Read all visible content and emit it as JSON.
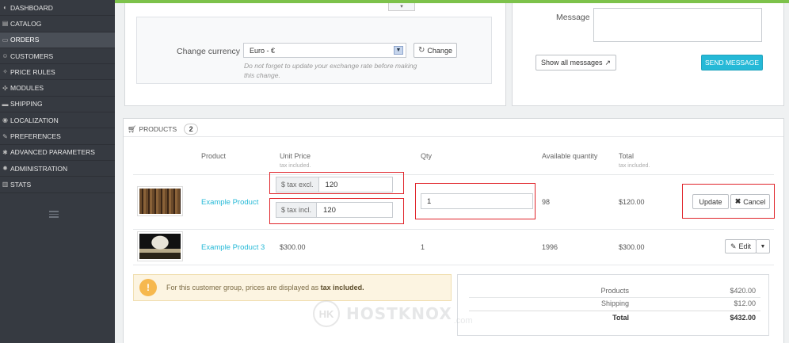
{
  "sidebar": {
    "items": [
      {
        "label": "DASHBOARD",
        "icon": "dashboard-icon",
        "glyph": "◐",
        "active": false
      },
      {
        "label": "CATALOG",
        "icon": "catalog-icon",
        "glyph": "▤",
        "active": false
      },
      {
        "label": "ORDERS",
        "icon": "orders-icon",
        "glyph": "▭",
        "active": true
      },
      {
        "label": "CUSTOMERS",
        "icon": "customers-icon",
        "glyph": "☺",
        "active": false
      },
      {
        "label": "PRICE RULES",
        "icon": "price-rules-icon",
        "glyph": "✧",
        "active": false
      },
      {
        "label": "MODULES",
        "icon": "modules-icon",
        "glyph": "✣",
        "active": false
      },
      {
        "label": "SHIPPING",
        "icon": "shipping-icon",
        "glyph": "▬",
        "active": false
      },
      {
        "label": "LOCALIZATION",
        "icon": "localization-icon",
        "glyph": "◉",
        "active": false
      },
      {
        "label": "PREFERENCES",
        "icon": "preferences-icon",
        "glyph": "✎",
        "active": false
      },
      {
        "label": "ADVANCED PARAMETERS",
        "icon": "advanced-parameters-icon",
        "glyph": "✱",
        "active": false
      },
      {
        "label": "ADMINISTRATION",
        "icon": "administration-icon",
        "glyph": "✹",
        "active": false
      },
      {
        "label": "STATS",
        "icon": "stats-icon",
        "glyph": "▥",
        "active": false
      }
    ]
  },
  "currency": {
    "small_select": "▾",
    "label": "Change currency",
    "selected": "Euro - €",
    "button": "Change",
    "note": "Do not forget to update your exchange rate before making this change."
  },
  "messages": {
    "label": "Message",
    "show_all": "Show all messages",
    "send": "SEND MESSAGE"
  },
  "products": {
    "heading": "PRODUCTS",
    "count": "2",
    "columns": {
      "product": "Product",
      "unit_price": "Unit Price",
      "unit_price_sub": "tax included.",
      "qty": "Qty",
      "available": "Available quantity",
      "total": "Total",
      "total_sub": "tax included."
    },
    "rows": [
      {
        "name": "Example Product",
        "tax_excl_label": "$ tax excl.",
        "tax_excl_value": "120",
        "tax_incl_label": "$ tax incl.",
        "tax_incl_value": "120",
        "qty": "1",
        "available": "98",
        "total": "$120.00",
        "update": "Update",
        "cancel": "Cancel"
      },
      {
        "name": "Example Product 3",
        "unit_price": "$300.00",
        "qty": "1",
        "available": "1996",
        "total": "$300.00",
        "edit": "Edit"
      }
    ]
  },
  "alert": {
    "text": "For this customer group, prices are displayed as",
    "bold": "tax included."
  },
  "totals": {
    "products_label": "Products",
    "products_value": "$420.00",
    "shipping_label": "Shipping",
    "shipping_value": "$12.00",
    "total_label": "Total",
    "total_value": "$432.00"
  },
  "watermark": {
    "logo": "HK",
    "text": "HOSTKNOX",
    "suffix": ".com"
  },
  "colors": {
    "sidebar_bg": "#363a41",
    "top_bar": "#7dc24b",
    "accent": "#25b9d7",
    "highlight_box": "#e0242a",
    "alert_bg": "#fcf4e1"
  }
}
